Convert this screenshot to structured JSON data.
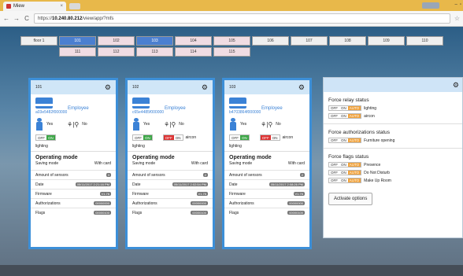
{
  "browser": {
    "tab_title": "Miew",
    "tab_close": "×",
    "url_prefix": "https://",
    "url_host": "10.240.80.212",
    "url_path": "/view/app/?mfs",
    "nav_back": "←",
    "nav_forward": "→",
    "nav_reload": "C",
    "bookmark": "☆"
  },
  "floors": {
    "row1": [
      {
        "label": "floor 1",
        "state": "normal"
      },
      {
        "label": "101",
        "state": "selected",
        "pin": false
      },
      {
        "label": "102",
        "state": "pink",
        "pin": true
      },
      {
        "label": "103",
        "state": "selected",
        "pin": true
      },
      {
        "label": "104",
        "state": "pink"
      },
      {
        "label": "105",
        "state": "pink"
      },
      {
        "label": "106",
        "state": "normal"
      },
      {
        "label": "107",
        "state": "normal"
      },
      {
        "label": "108",
        "state": "normal"
      },
      {
        "label": "109",
        "state": "normal"
      },
      {
        "label": "110",
        "state": "normal"
      }
    ],
    "row2": [
      "111",
      "112",
      "113",
      "114",
      "115"
    ]
  },
  "cards": [
    {
      "room": "101",
      "employee_label": "Employee",
      "card_id": "a03e5482f000000",
      "yes_label": "Yes",
      "no_label": "No",
      "relay": {
        "off": "OFF",
        "on": "ON",
        "state": "on",
        "name": "lighting"
      },
      "relay_name": "lighting",
      "op_mode_title": "Operating mode",
      "saving_mode_label": "Saving mode",
      "saving_mode_value": "With card",
      "amount_label": "Amount of sensors",
      "amount_value": "3",
      "date_label": "Date",
      "date_value": "05/11/2017 2:21:16 PM",
      "firmware_label": "Firmware",
      "firmware_value": "V1.76",
      "auth_label": "Authorizations",
      "auth_value": "00000000",
      "flags_label": "Flags",
      "flags_value": "00000100"
    },
    {
      "room": "102",
      "employee_label": "Employee",
      "card_id": "c65e4485f000000",
      "yes_label": "Yes",
      "no_label": "No",
      "relay": {
        "off": "OFF",
        "on": "ON",
        "state": "on",
        "name": "lighting"
      },
      "relay2": {
        "off": "OFF",
        "on": "ON",
        "state": "off",
        "name": "aircon"
      },
      "relay_name": "lighting",
      "op_mode_title": "Operating mode",
      "saving_mode_label": "Saving mode",
      "saving_mode_value": "With card",
      "amount_label": "Amount of sensors",
      "amount_value": "2",
      "date_label": "Date",
      "date_value": "05/11/2017 2:02:54 PM",
      "firmware_label": "Firmware",
      "firmware_value": "V1.76",
      "auth_label": "Authorizations",
      "auth_value": "00000000",
      "flags_label": "Flags",
      "flags_value": "00000100"
    },
    {
      "room": "103",
      "employee_label": "Employee",
      "card_id": "b4703864f000000",
      "yes_label": "Yes",
      "no_label": "No",
      "relay": {
        "off": "OFF",
        "on": "ON",
        "state": "on",
        "name": "lighting"
      },
      "relay2": {
        "off": "OFF",
        "on": "ON",
        "state": "off",
        "name": "aircon"
      },
      "relay_name": "lighting",
      "op_mode_title": "Operating mode",
      "saving_mode_label": "Saving mode",
      "saving_mode_value": "With card",
      "amount_label": "Amount of sensors",
      "amount_value": "2",
      "date_label": "Date",
      "date_value": "05/11/2017 2:08:26 PM",
      "firmware_label": "Firmware",
      "firmware_value": "V1.76",
      "auth_label": "Authorizations",
      "auth_value": "00000000",
      "flags_label": "Flags",
      "flags_value": "00000100"
    }
  ],
  "force": {
    "relay_title": "Force relay status",
    "relay_rows": [
      {
        "off": "OFF",
        "on": "ON",
        "auto": "AUTO",
        "name": "lighting"
      },
      {
        "off": "OFF",
        "on": "ON",
        "auto": "AUTO",
        "name": "aircon"
      }
    ],
    "auth_title": "Force authorizations status",
    "auth_rows": [
      {
        "off": "OFF",
        "on": "ON",
        "auto": "AUTO",
        "name": "Furniture opening"
      }
    ],
    "flags_title": "Force flags status",
    "flags_rows": [
      {
        "off": "OFF",
        "on": "ON",
        "auto": "AUTO",
        "name": "Presence"
      },
      {
        "off": "OFF",
        "on": "ON",
        "auto": "AUTO",
        "name": "Do Not Disturb"
      },
      {
        "off": "OFF",
        "on": "ON",
        "auto": "AUTO",
        "name": "Make Up Room"
      }
    ],
    "activate_label": "Activate options"
  },
  "colors": {
    "accent": "#3b82d6",
    "on": "#3ca646",
    "off": "#d33333",
    "auto": "#f0a23c"
  }
}
